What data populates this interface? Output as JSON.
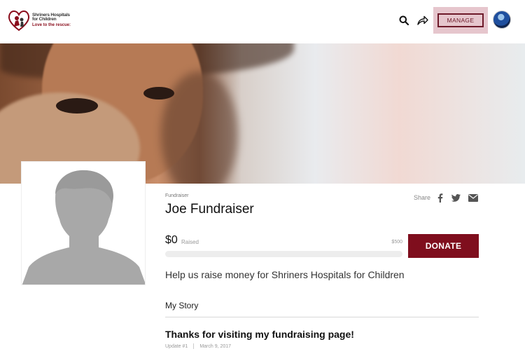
{
  "header": {
    "logo": {
      "line1": "Shriners Hospitals",
      "line2": "for Children",
      "line3": "Love to the rescue:"
    },
    "icons": {
      "search": "search-icon",
      "share": "share-arrow-icon"
    },
    "manage_label": "MANAGE",
    "avatar": "user-avatar"
  },
  "profile": {
    "section_label": "Fundraiser",
    "name": "Joe Fundraiser",
    "share_label": "Share",
    "social_icons": [
      "facebook-icon",
      "twitter-icon",
      "email-icon"
    ]
  },
  "fundraising": {
    "raised_amount": "$0",
    "raised_label": "Raised",
    "goal_amount": "$500",
    "progress_fraction": 0,
    "donate_label": "DONATE",
    "tagline": "Help us raise money for Shriners Hospitals for Children"
  },
  "story": {
    "heading": "My Story",
    "update_title": "Thanks for visiting my fundraising page!",
    "update_number": "Update #1",
    "update_date": "March 9, 2017"
  },
  "colors": {
    "brand": "#8a0d1c",
    "donate_bg": "#7f0e1d",
    "manage_highlight": "#e6c6cd"
  }
}
